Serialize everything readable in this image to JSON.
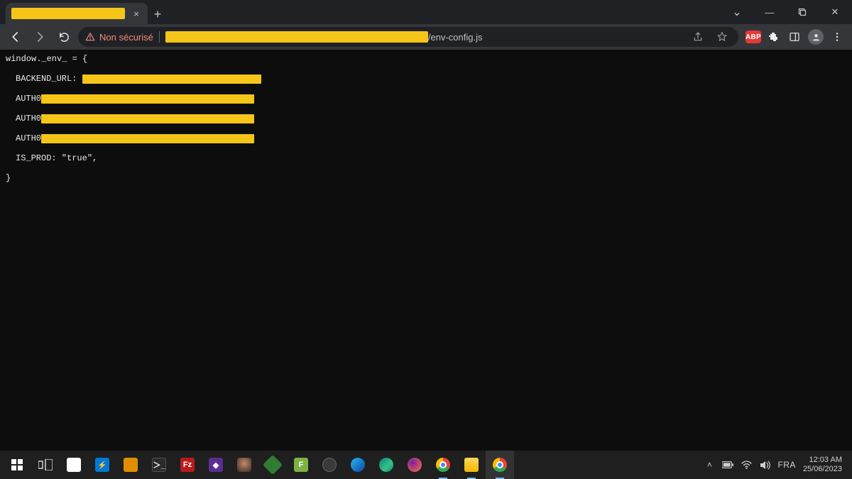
{
  "tab": {
    "close": "×"
  },
  "newtab_glyph": "+",
  "window": {
    "chevron": "⌄",
    "min": "—",
    "close": "✕"
  },
  "toolbar": {
    "not_secure": "Non sécurisé",
    "url_path": "/env-config.js",
    "abp": "ABP"
  },
  "code": {
    "line1": "window._env_ = {",
    "line2_key": "BACKEND_URL:",
    "line3_key": "AUTH0",
    "line4_key": "AUTH0",
    "line5_key": "AUTH0",
    "line6": "IS_PROD: \"true\",",
    "line7": "}"
  },
  "tray": {
    "lang": "FRA",
    "time": "12:03 AM",
    "date": "25/06/2023",
    "chevron": "˄"
  }
}
